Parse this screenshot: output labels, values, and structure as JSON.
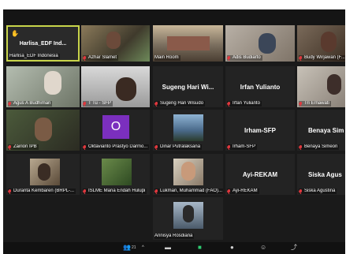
{
  "participants": [
    {
      "label": "Harlisa_EDF Indonesia",
      "display": "Harlisa_EDF  Ind...",
      "muted": false,
      "hand": true
    },
    {
      "label": "Azhar Slamet",
      "muted": true
    },
    {
      "label": "Main Room",
      "muted": false
    },
    {
      "label": "Adis Budiarto",
      "muted": true
    },
    {
      "label": "Budy Wirjawan (F...",
      "muted": true
    },
    {
      "label": "Agus A Budhiman",
      "muted": true
    },
    {
      "label": "T Tu - SFP",
      "muted": true
    },
    {
      "label": "Sugeng Hari Wisudo",
      "display": "Sugeng  Hari  Wi...",
      "muted": true
    },
    {
      "label": "Irfan Yulianto",
      "display": "Irfan Yulianto",
      "muted": true
    },
    {
      "label": "Tri Ernawati",
      "muted": true
    },
    {
      "label": "Zairion IPB",
      "muted": true
    },
    {
      "label": "Oktavianto Prastyo Darmo...",
      "avatar": "O",
      "muted": true
    },
    {
      "label": "Dinar Putralaksana",
      "muted": true
    },
    {
      "label": "Irham-SFP",
      "display": "Irham-SFP",
      "muted": true
    },
    {
      "label": "Benaya Simeon",
      "display": "Benaya Sim",
      "muted": true
    },
    {
      "label": "Duranta Kembaren (BRPL-...",
      "muted": true
    },
    {
      "label": "ISLME Maria Endah Hulupi",
      "muted": true
    },
    {
      "label": "Lukman, Muhammad (FAO)...",
      "muted": true
    },
    {
      "label": "Ayi-REKAM",
      "display": "Ayi-REKAM",
      "muted": true
    },
    {
      "label": "Siska Agustina",
      "display": "Siska Agus",
      "muted": true
    },
    {
      "label": "Annisya Rosdiana",
      "muted": false
    }
  ],
  "toolbar": {
    "participants_count": "21"
  },
  "colors": {
    "active_border": "#c8d44a",
    "muted_icon": "#e0383e",
    "background": "#1a1a1a",
    "avatar_o": "#7b2fbe"
  }
}
